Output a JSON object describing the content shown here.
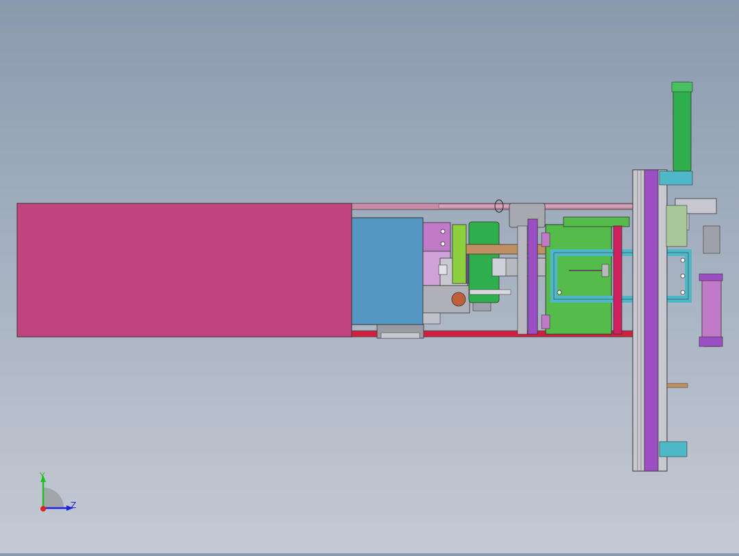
{
  "view": {
    "background_top": "#8a9aae",
    "background_bottom": "#c4cad4"
  },
  "triad": {
    "y_label": "Y",
    "z_label": "Z",
    "y_color": "#20c020",
    "z_color": "#2020e0",
    "x_color": "#e02020"
  },
  "colors": {
    "magenta_housing": "#c0447e",
    "blue_block": "#5596c2",
    "green_plate": "#55bb4a",
    "cylinder_green": "#2fae4e",
    "purple": "#9b4fc2",
    "lilac": "#c07ac8",
    "teal": "#4fb8c8",
    "gray": "#a8a8b0",
    "tan": "#c09060",
    "crimson": "#d02060",
    "lime": "#8cd040",
    "copper": "#c0603a",
    "light_green": "#a8c89a"
  }
}
